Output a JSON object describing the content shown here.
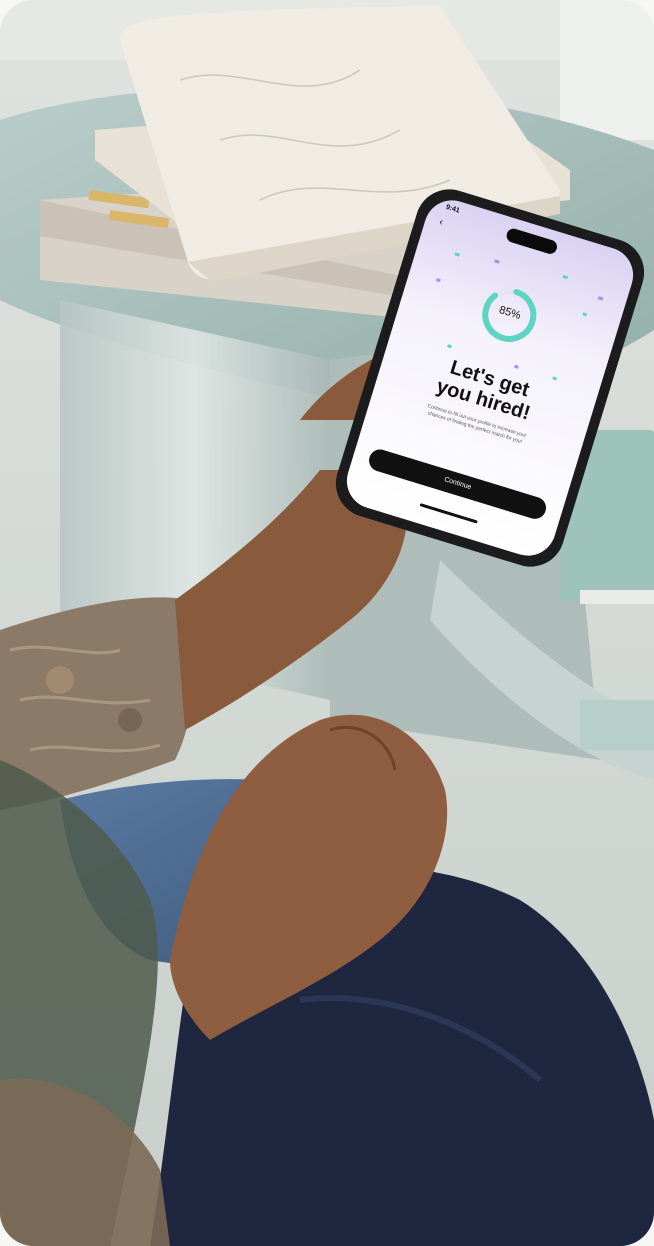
{
  "photo": {
    "scene": "person-holding-phone",
    "colors": {
      "table": "#a9c0bc",
      "book": "#ece7de",
      "skin": "#8a5a3c",
      "sleeve": "#8c7a68",
      "jeans": "#4a6a92",
      "trousers": "#1f2740",
      "phone_body": "#1c1c1e",
      "ring_accent": "#5fd3c4",
      "button_bg": "#111111"
    }
  },
  "phone": {
    "status_time": "9:41",
    "back_icon": "chevron-left-icon",
    "progress": {
      "percent": 0.85,
      "label": "85%"
    },
    "heading_line1": "Let's get",
    "heading_line2": "you hired!",
    "body_line1": "Continue to fill out your profile to increase your",
    "body_line2": "chances of finding the perfect match for you!",
    "button_label": "Continue"
  }
}
